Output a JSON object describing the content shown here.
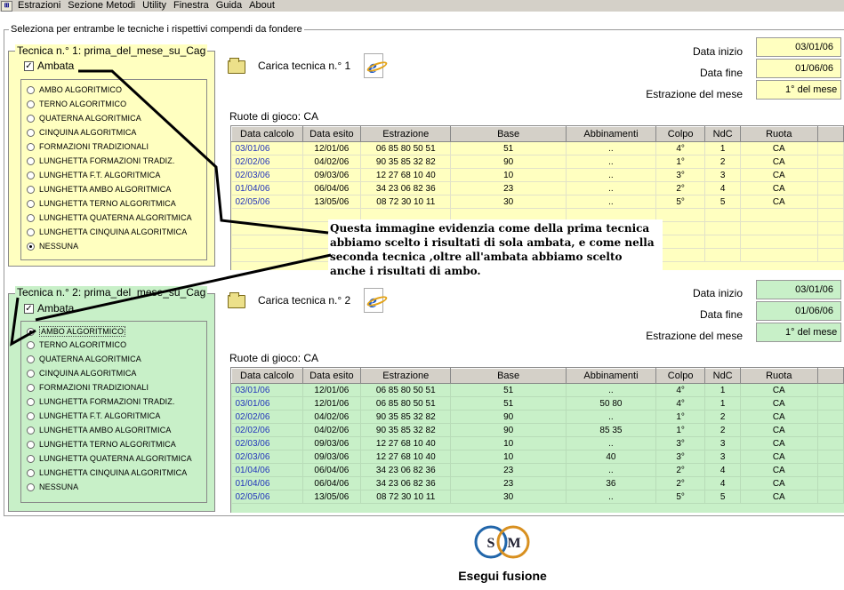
{
  "menubar": {
    "app_icon": "app-icon",
    "items": [
      "Estrazioni",
      "Sezione Metodi",
      "Utility",
      "Finestra",
      "Guida",
      "About"
    ]
  },
  "group_title": "Seleziona per entrambe le tecniche i rispettivi compendi da fondere",
  "radio_options": [
    "AMBO ALGORITMICO",
    "TERNO ALGORITMICO",
    "QUATERNA ALGORITMICA",
    "CINQUINA ALGORITMICA",
    "FORMAZIONI TRADIZIONALI",
    "LUNGHETTA FORMAZIONI TRADIZ.",
    "LUNGHETTA F.T. ALGORITMICA",
    "LUNGHETTA AMBO ALGORITMICA",
    "LUNGHETTA TERNO ALGORITMICA",
    "LUNGHETTA QUATERNA ALGORITMICA",
    "LUNGHETTA CINQUINA ALGORITMICA",
    "NESSUNA"
  ],
  "table_headers": [
    "Data calcolo",
    "Data esito",
    "Estrazione",
    "Base",
    "Abbinamenti",
    "Colpo",
    "NdC",
    "Ruota"
  ],
  "colors": {
    "yellow_bg": "#ffffc0",
    "green_bg": "#c8f0c8",
    "link_blue": "#2233bb"
  },
  "tecnica1": {
    "title": "Tecnica n.° 1: prima_del_mese_su_Cag",
    "ambata_label": "Ambata",
    "ambata_checked": true,
    "selected": "NESSUNA",
    "load_label": "Carica tecnica n.° 1",
    "data_inizio_label": "Data inizio",
    "data_inizio": "03/01/06",
    "data_fine_label": "Data fine",
    "data_fine": "01/06/06",
    "estrazione_label": "Estrazione del mese",
    "estrazione": "1° del mese",
    "ruote_label": "Ruote di gioco: CA",
    "rows": [
      [
        "03/01/06",
        "12/01/06",
        "06 85 80 50 51",
        "51",
        "..",
        "4°",
        "1",
        "CA"
      ],
      [
        "02/02/06",
        "04/02/06",
        "90 35 85 32 82",
        "90",
        "..",
        "1°",
        "2",
        "CA"
      ],
      [
        "02/03/06",
        "09/03/06",
        "12 27 68 10 40",
        "10",
        "..",
        "3°",
        "3",
        "CA"
      ],
      [
        "01/04/06",
        "06/04/06",
        "34 23 06 82 36",
        "23",
        "..",
        "2°",
        "4",
        "CA"
      ],
      [
        "02/05/06",
        "13/05/06",
        "08 72 30 10 11",
        "30",
        "..",
        "5°",
        "5",
        "CA"
      ]
    ]
  },
  "tecnica2": {
    "title": "Tecnica n.° 2: prima_del_mese_su_Cag",
    "ambata_label": "Ambata",
    "ambata_checked": true,
    "selected": "AMBO ALGORITMICO",
    "load_label": "Carica tecnica n.° 2",
    "data_inizio_label": "Data inizio",
    "data_inizio": "03/01/06",
    "data_fine_label": "Data fine",
    "data_fine": "01/06/06",
    "estrazione_label": "Estrazione del mese",
    "estrazione": "1° del mese",
    "ruote_label": "Ruote di gioco: CA",
    "rows": [
      [
        "03/01/06",
        "12/01/06",
        "06 85 80 50 51",
        "51",
        "..",
        "4°",
        "1",
        "CA"
      ],
      [
        "03/01/06",
        "12/01/06",
        "06 85 80 50 51",
        "51",
        "50 80",
        "4°",
        "1",
        "CA"
      ],
      [
        "02/02/06",
        "04/02/06",
        "90 35 85 32 82",
        "90",
        "..",
        "1°",
        "2",
        "CA"
      ],
      [
        "02/02/06",
        "04/02/06",
        "90 35 85 32 82",
        "90",
        "85 35",
        "1°",
        "2",
        "CA"
      ],
      [
        "02/03/06",
        "09/03/06",
        "12 27 68 10 40",
        "10",
        "..",
        "3°",
        "3",
        "CA"
      ],
      [
        "02/03/06",
        "09/03/06",
        "12 27 68 10 40",
        "10",
        "40",
        "3°",
        "3",
        "CA"
      ],
      [
        "01/04/06",
        "06/04/06",
        "34 23 06 82 36",
        "23",
        "..",
        "2°",
        "4",
        "CA"
      ],
      [
        "01/04/06",
        "06/04/06",
        "34 23 06 82 36",
        "23",
        "36",
        "2°",
        "4",
        "CA"
      ],
      [
        "02/05/06",
        "13/05/06",
        "08 72 30 10 11",
        "30",
        "..",
        "5°",
        "5",
        "CA"
      ]
    ]
  },
  "annotation": "Questa immagine evidenzia come della prima tecnica abbiamo scelto i risultati di sola ambata, e come nella seconda tecnica ,oltre all'ambata abbiamo scelto anche i risultati di ambo.",
  "logo_letters": [
    "S",
    "M"
  ],
  "run_label": "Esegui fusione"
}
